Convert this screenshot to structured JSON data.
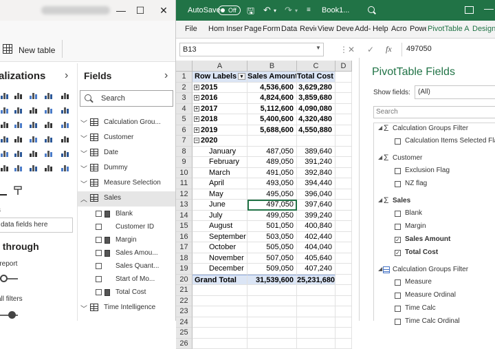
{
  "powerbi": {
    "new_table_label": "New table",
    "visualizations_title": "alizations",
    "fields_title": "Fields",
    "search_placeholder": "Search",
    "values_label": "s",
    "drop_hint": "data fields here",
    "drill_title": "l through",
    "cross_report_label": "-report",
    "keep_filters_label": "all filters",
    "tables": [
      {
        "label": "Calculation Grou...",
        "expanded": false
      },
      {
        "label": "Customer",
        "expanded": false
      },
      {
        "label": "Date",
        "expanded": false
      },
      {
        "label": "Dummy",
        "expanded": false
      },
      {
        "label": "Measure Selection",
        "expanded": false
      },
      {
        "label": "Sales",
        "expanded": true
      }
    ],
    "sales_fields": [
      {
        "label": "Blank",
        "measure": true
      },
      {
        "label": "Customer ID",
        "measure": false
      },
      {
        "label": "Margin",
        "measure": true
      },
      {
        "label": "Sales Amou...",
        "measure": true
      },
      {
        "label": "Sales Quant...",
        "measure": false
      },
      {
        "label": "Start of Mo...",
        "measure": false
      },
      {
        "label": "Total Cost",
        "measure": true
      }
    ],
    "last_table": "Time Intelligence"
  },
  "excel": {
    "autosave_label": "AutoSave",
    "autosave_state": "Off",
    "book_title": "Book1...",
    "tabs": [
      "File",
      "Hom",
      "Inser",
      "Page",
      "Form",
      "Data",
      "Revie",
      "View",
      "Deve",
      "Add-",
      "Help",
      "Acro",
      "Powe",
      "PivotTable A",
      "Design"
    ],
    "name_box": "B13",
    "formula_value": "497050",
    "columns": [
      "A",
      "B",
      "C",
      "D"
    ],
    "pivot": {
      "headers": [
        "Row Labels",
        "Sales Amount",
        "Total Cost"
      ],
      "rows": [
        {
          "row": "2",
          "label": "2015",
          "sales": "4,536,600",
          "cost": "3,629,280",
          "level": "year",
          "collapsed": true
        },
        {
          "row": "3",
          "label": "2016",
          "sales": "4,824,600",
          "cost": "3,859,680",
          "level": "year",
          "collapsed": true
        },
        {
          "row": "4",
          "label": "2017",
          "sales": "5,112,600",
          "cost": "4,090,080",
          "level": "year",
          "collapsed": true
        },
        {
          "row": "5",
          "label": "2018",
          "sales": "5,400,600",
          "cost": "4,320,480",
          "level": "year",
          "collapsed": true
        },
        {
          "row": "6",
          "label": "2019",
          "sales": "5,688,600",
          "cost": "4,550,880",
          "level": "year",
          "collapsed": true
        },
        {
          "row": "7",
          "label": "2020",
          "sales": "",
          "cost": "",
          "level": "year",
          "collapsed": false
        },
        {
          "row": "8",
          "label": "January",
          "sales": "487,050",
          "cost": "389,640",
          "level": "month"
        },
        {
          "row": "9",
          "label": "February",
          "sales": "489,050",
          "cost": "391,240",
          "level": "month"
        },
        {
          "row": "10",
          "label": "March",
          "sales": "491,050",
          "cost": "392,840",
          "level": "month"
        },
        {
          "row": "11",
          "label": "April",
          "sales": "493,050",
          "cost": "394,440",
          "level": "month"
        },
        {
          "row": "12",
          "label": "May",
          "sales": "495,050",
          "cost": "396,040",
          "level": "month"
        },
        {
          "row": "13",
          "label": "June",
          "sales": "497,050",
          "cost": "397,640",
          "level": "month"
        },
        {
          "row": "14",
          "label": "July",
          "sales": "499,050",
          "cost": "399,240",
          "level": "month"
        },
        {
          "row": "15",
          "label": "August",
          "sales": "501,050",
          "cost": "400,840",
          "level": "month"
        },
        {
          "row": "16",
          "label": "September",
          "sales": "503,050",
          "cost": "402,440",
          "level": "month"
        },
        {
          "row": "17",
          "label": "October",
          "sales": "505,050",
          "cost": "404,040",
          "level": "month"
        },
        {
          "row": "18",
          "label": "November",
          "sales": "507,050",
          "cost": "405,640",
          "level": "month"
        },
        {
          "row": "19",
          "label": "December",
          "sales": "509,050",
          "cost": "407,240",
          "level": "month"
        }
      ],
      "grand_total": {
        "row": "20",
        "label": "Grand Total",
        "sales": "31,539,600",
        "cost": "25,231,680"
      },
      "empty_rows": [
        "21",
        "22",
        "23",
        "24",
        "25",
        "26"
      ]
    },
    "pivot_pane": {
      "title": "PivotTable Fields",
      "show_fields_label": "Show fields:",
      "show_fields_value": "(All)",
      "search_placeholder": "Search",
      "items": [
        {
          "type": "group",
          "label": "Calculation Groups Filter",
          "icon": "sigma"
        },
        {
          "type": "field",
          "label": "Calculation Items Selected Flag",
          "checked": false
        },
        {
          "type": "spacer"
        },
        {
          "type": "group",
          "label": "Customer",
          "icon": "sigma"
        },
        {
          "type": "field",
          "label": "Exclusion Flag",
          "checked": false
        },
        {
          "type": "field",
          "label": "NZ flag",
          "checked": false
        },
        {
          "type": "spacer"
        },
        {
          "type": "group",
          "label": "Sales",
          "icon": "sigma",
          "bold": true
        },
        {
          "type": "field",
          "label": "Blank",
          "checked": false
        },
        {
          "type": "field",
          "label": "Margin",
          "checked": false
        },
        {
          "type": "field",
          "label": "Sales Amount",
          "checked": true
        },
        {
          "type": "field",
          "label": "Total Cost",
          "checked": true
        },
        {
          "type": "spacer"
        },
        {
          "type": "group",
          "label": "Calculation Groups Filter",
          "icon": "table"
        },
        {
          "type": "field",
          "label": "Measure",
          "checked": false
        },
        {
          "type": "field",
          "label": "Measure Ordinal",
          "checked": false
        },
        {
          "type": "field",
          "label": "Time Calc",
          "checked": false
        },
        {
          "type": "field",
          "label": "Time Calc Ordinal",
          "checked": false
        }
      ]
    }
  }
}
